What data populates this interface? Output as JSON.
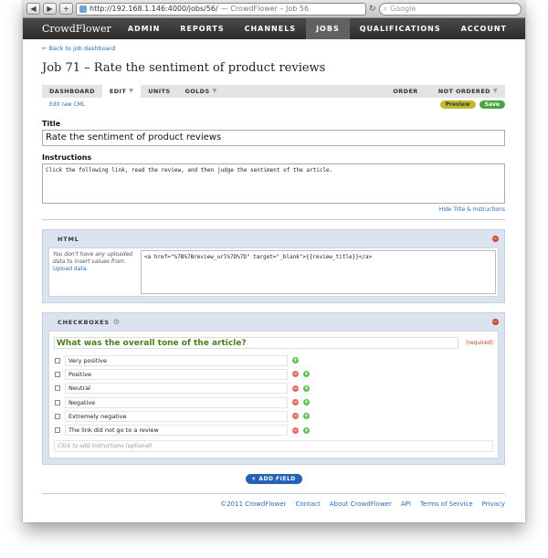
{
  "browser": {
    "url": "http://192.168.1.146:4000/jobs/56/",
    "page_title": "— CrowdFlower – Job 56",
    "search_placeholder": "Google",
    "back_icon": "back-arrow",
    "forward_icon": "forward-arrow",
    "add_icon": "plus",
    "reload_icon": "reload"
  },
  "site": {
    "logo": "CrowdFlower",
    "nav": [
      {
        "label": "ADMIN"
      },
      {
        "label": "REPORTS"
      },
      {
        "label": "CHANNELS"
      },
      {
        "label": "JOBS"
      },
      {
        "label": "QUALIFICATIONS"
      },
      {
        "label": "ACCOUNT"
      }
    ]
  },
  "page": {
    "back_link": "← Back to job dashboard",
    "title": "Job 71 – Rate the sentiment of product reviews",
    "tabs": [
      {
        "label": "DASHBOARD"
      },
      {
        "label": "EDIT"
      },
      {
        "label": "UNITS"
      },
      {
        "label": "GOLDS"
      }
    ],
    "order_label": "ORDER",
    "order_value": "NOT ORDERED",
    "edit_raw": "Edit raw CML",
    "preview": "Preview",
    "save": "Save",
    "title_label": "Title",
    "title_value": "Rate the sentiment of product reviews",
    "instructions_label": "Instructions",
    "instructions_value": "Click the following link, read the review, and then judge the sentiment of the article.",
    "hide_link": "Hide Title & Instructions"
  },
  "html_panel": {
    "header": "HTML",
    "note": "You don't have any uploaded data to insert values from.",
    "note_link": "Upload data.",
    "code": "<a href=\"%7B%7Breview_url%7D%7D\" target=\"_blank\">{{review_title}}</a>"
  },
  "checkbox_panel": {
    "header": "CHECKBOXES",
    "question": "What was the overall tone of the article?",
    "required": "(required)",
    "options": [
      "Very positive",
      "Positive",
      "Neutral",
      "Negative",
      "Extremely negative",
      "The link did not go to a review"
    ],
    "instructions_placeholder": "Click to add instructions (optional)"
  },
  "add_field": "+ ADD FIELD",
  "footer": {
    "copyright": "©2011 CrowdFlower",
    "links": [
      "Contact",
      "About CrowdFlower",
      "API",
      "Terms of Service",
      "Privacy"
    ]
  }
}
